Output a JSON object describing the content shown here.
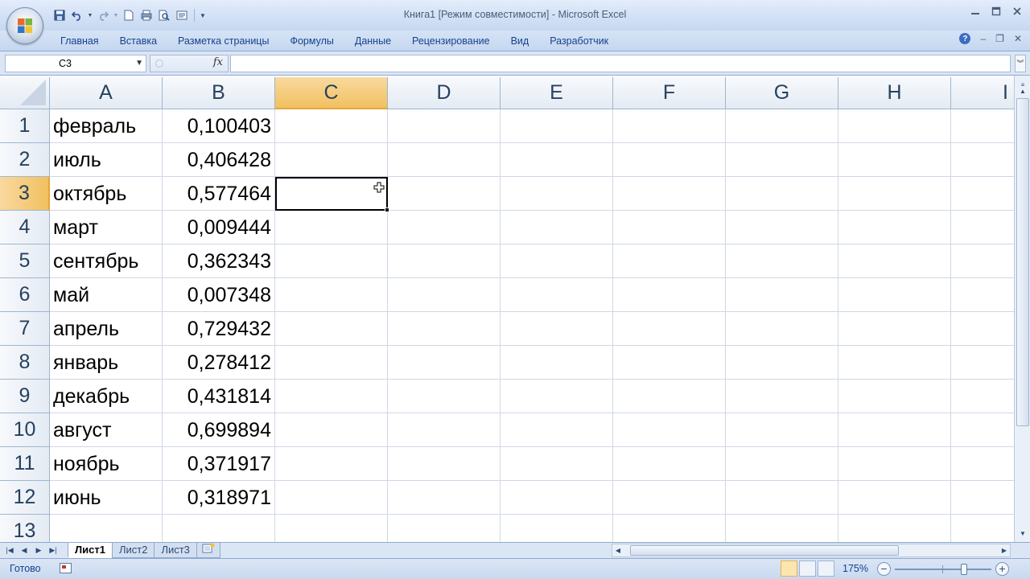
{
  "app": {
    "title": "Книга1  [Режим совместимости] - Microsoft Excel"
  },
  "ribbon": {
    "tabs": [
      "Главная",
      "Вставка",
      "Разметка страницы",
      "Формулы",
      "Данные",
      "Рецензирование",
      "Вид",
      "Разработчик"
    ]
  },
  "formula_bar": {
    "name_box": "C3",
    "fx_label": "fx",
    "formula": ""
  },
  "grid": {
    "columns": [
      "A",
      "B",
      "C",
      "D",
      "E",
      "F",
      "G",
      "H",
      "I"
    ],
    "active_column": "C",
    "active_row": 3,
    "selected_cell": "C3",
    "rows": [
      {
        "num": "1",
        "a": "февраль",
        "b": "0,100403"
      },
      {
        "num": "2",
        "a": "июль",
        "b": "0,406428"
      },
      {
        "num": "3",
        "a": "октябрь",
        "b": "0,577464"
      },
      {
        "num": "4",
        "a": "март",
        "b": "0,009444"
      },
      {
        "num": "5",
        "a": "сентябрь",
        "b": "0,362343"
      },
      {
        "num": "6",
        "a": "май",
        "b": "0,007348"
      },
      {
        "num": "7",
        "a": "апрель",
        "b": "0,729432"
      },
      {
        "num": "8",
        "a": "январь",
        "b": "0,278412"
      },
      {
        "num": "9",
        "a": "декабрь",
        "b": "0,431814"
      },
      {
        "num": "10",
        "a": "август",
        "b": "0,699894"
      },
      {
        "num": "11",
        "a": "ноябрь",
        "b": "0,371917"
      },
      {
        "num": "12",
        "a": "июнь",
        "b": "0,318971"
      },
      {
        "num": "13",
        "a": "",
        "b": ""
      }
    ]
  },
  "sheets": {
    "tabs": [
      "Лист1",
      "Лист2",
      "Лист3"
    ],
    "active": "Лист1"
  },
  "status": {
    "ready": "Готово",
    "zoom": "175%",
    "zoom_level": 0.72
  },
  "icons": {
    "office_button": "office-logo-icon",
    "qat": [
      "save-icon",
      "undo-icon",
      "redo-icon",
      "new-icon",
      "print-icon",
      "print-preview-icon",
      "form-icon",
      "customize-qat-icon"
    ],
    "window": [
      "minimize-icon",
      "maximize-icon",
      "close-icon"
    ]
  },
  "colors": {
    "active_header": "#f1c15f",
    "grid_line": "#d0d7e5",
    "ribbon_text": "#15428b"
  }
}
